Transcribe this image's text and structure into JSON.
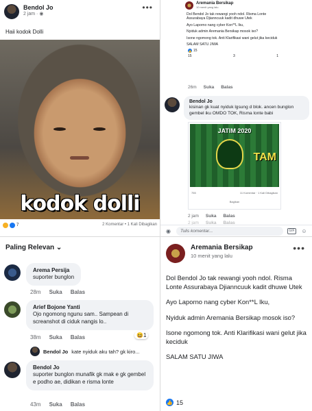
{
  "post1": {
    "author": "Bendol Jo",
    "time": "2 jam · ◉",
    "caption": "Haii kodok Dolli",
    "meme_text": "kodok dolli",
    "reaction_count": "7",
    "comments_count": "2 Komentar",
    "shares": "1 Kali Dibagikan"
  },
  "post2": {
    "screenshot": {
      "author": "Aremania Bersikap",
      "time": "10 menit yang lalu",
      "paragraphs": [
        "Dol Bendol Jo tak rewangi yooh ndol. Risma Lonte Assurabaya Djianncuuk kadit dhuwe Utek",
        "Ayo Laporno nang cyber Kon**L Iku,",
        "Nyiduk admin Aremania Bersikap mosok iso?",
        "Isone ngomong tok. Anti Klarifikasi wani gelut jika keciduk",
        "SALAM SATU JIWA"
      ],
      "likes": "15",
      "stat_a": "15",
      "stat_b": "3",
      "stat_c": "1"
    },
    "action1": {
      "time": "26m",
      "like": "Suka",
      "reply": "Balas"
    },
    "comment": {
      "author": "Bendol Jo",
      "text": "kisinan gk kuat nyiduk lgsung d blok. ancen bunglon gembel iku OMDO TOK, Risma lonte babi"
    },
    "shared_poster": {
      "title": "JATIM 2020",
      "tam": "TAM"
    },
    "shared_meta_left": "755",
    "shared_meta_right": "11 Komentar · 1 Kali Dibagikan",
    "shared_action": "Bagikan",
    "action2": {
      "time": "2 jam",
      "like": "Suka",
      "reply": "Balas"
    },
    "action3": {
      "time": "2 jam",
      "like": "Suka",
      "reply": "Balas"
    },
    "input_placeholder": "Tulis komentar...",
    "gif_label": "GIF"
  },
  "comments": {
    "sort_label": "Paling Relevan",
    "items": [
      {
        "author": "Arema Persija",
        "text": "suporter bunglon",
        "time": "28m",
        "like": "Suka",
        "reply": "Balas"
      },
      {
        "author": "Arief Bojone Yanti",
        "text": "Ojo ngomong ngunu sam.. Sampean di screanshot di ciduk nangis lo..",
        "time": "38m",
        "like": "Suka",
        "reply": "Balas",
        "reaction_count": "1"
      },
      {
        "author": "Bendol Jo",
        "text": "suporter bunglon munafik gk mak e gk gembel e podho ae, didikan e risma lonte",
        "time": "43m",
        "like": "Suka",
        "reply": "Balas"
      }
    ],
    "reply_preview": {
      "author": "Bendol Jo",
      "text": "kate nyiduk aku tah? gk kiro..."
    }
  },
  "post4": {
    "author": "Aremania Bersikap",
    "time": "10 menit yang lalu",
    "paragraphs": [
      "Dol Bendol Jo tak rewangi yooh ndol. Risma Lonte Assurabaya Djianncuuk kadit dhuwe Utek",
      "Ayo Laporno nang cyber Kon**L Iku,",
      "Nyiduk admin Aremania Bersikap mosok iso?",
      "Isone ngomong tok. Anti Klarifikasi wani gelut jika keciduk",
      "SALAM SATU JIWA"
    ],
    "likes": "15"
  },
  "colors": {
    "fb_blue": "#1877f2",
    "bubble": "#f0f2f5",
    "muted": "#65676b"
  }
}
